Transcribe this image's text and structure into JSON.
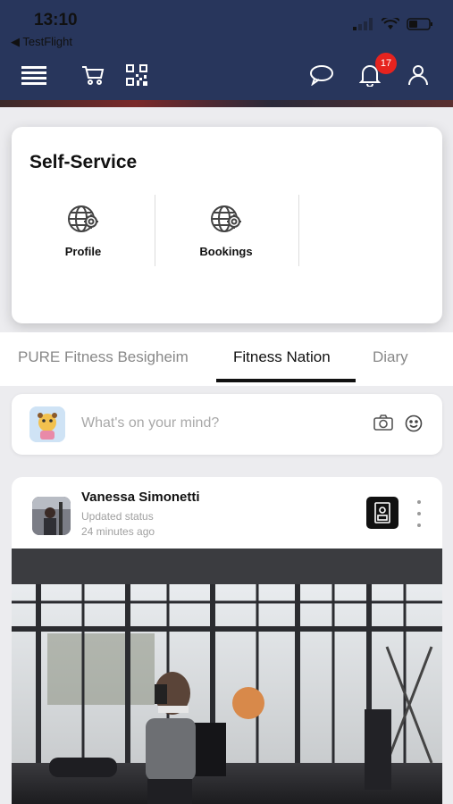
{
  "status_bar": {
    "time": "13:10",
    "back_app": "◀ TestFlight"
  },
  "toolbar": {
    "notification_count": "17"
  },
  "self_service": {
    "title": "Self-Service",
    "items": [
      {
        "label": "Profile",
        "icon": "globe-gear-icon"
      },
      {
        "label": "Bookings",
        "icon": "globe-gear-icon"
      }
    ]
  },
  "tabs": [
    {
      "label": "PURE Fitness Besigheim",
      "active": false
    },
    {
      "label": "Fitness Nation",
      "active": true
    },
    {
      "label": "Diary",
      "active": false
    }
  ],
  "composer": {
    "placeholder": "What's on your mind?"
  },
  "post": {
    "author": "Vanessa Simonetti",
    "subtitle": "Updated status",
    "time": "24 minutes ago"
  },
  "colors": {
    "header": "#28365c",
    "badge": "#e6231f",
    "accent": "#111111"
  }
}
